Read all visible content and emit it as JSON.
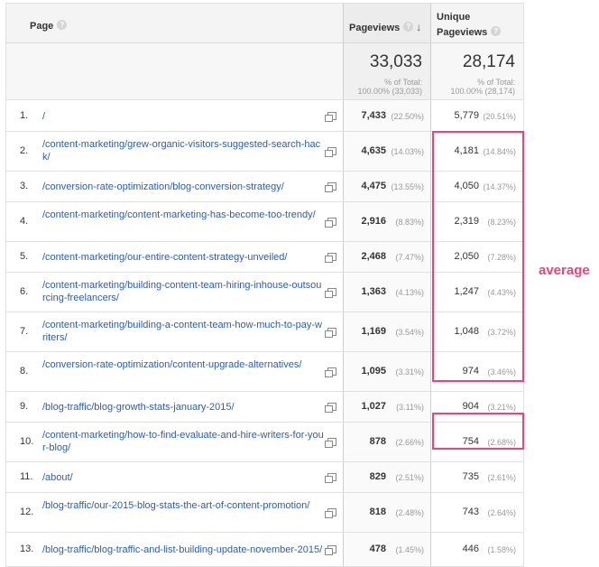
{
  "header": {
    "page_label": "Page",
    "pageviews_label": "Pageviews",
    "unique_label_line1": "Unique",
    "unique_label_line2": "Pageviews",
    "help_glyph": "?",
    "sort_glyph": "↓"
  },
  "totals": {
    "pageviews": "33,033",
    "pageviews_sub1": "% of Total:",
    "pageviews_sub2": "100.00% (33,033)",
    "unique": "28,174",
    "unique_sub1": "% of Total:",
    "unique_sub2": "100.00% (28,174)"
  },
  "rows": [
    {
      "rank": "1.",
      "url": "/",
      "pv": "7,433",
      "pv_pct": "(22.50%)",
      "upv": "5,779",
      "upv_pct": "(20.51%)"
    },
    {
      "rank": "2.",
      "url": "/content-marketing/grew-organic-visitors-suggested-search-hack/",
      "pv": "4,635",
      "pv_pct": "(14.03%)",
      "upv": "4,181",
      "upv_pct": "(14.84%)"
    },
    {
      "rank": "3.",
      "url": "/conversion-rate-optimization/blog-conversion-strategy/",
      "pv": "4,475",
      "pv_pct": "(13.55%)",
      "upv": "4,050",
      "upv_pct": "(14.37%)"
    },
    {
      "rank": "4.",
      "url": "/content-marketing/content-marketing-has-become-too-trendy/",
      "pv": "2,916",
      "pv_pct": "(8.83%)",
      "upv": "2,319",
      "upv_pct": "(8.23%)"
    },
    {
      "rank": "5.",
      "url": "/content-marketing/our-entire-content-strategy-unveiled/",
      "pv": "2,468",
      "pv_pct": "(7.47%)",
      "upv": "2,050",
      "upv_pct": "(7.28%)"
    },
    {
      "rank": "6.",
      "url": "/content-marketing/building-content-team-hiring-inhouse-outsourcing-freelancers/",
      "pv": "1,363",
      "pv_pct": "(4.13%)",
      "upv": "1,247",
      "upv_pct": "(4.43%)"
    },
    {
      "rank": "7.",
      "url": "/content-marketing/building-a-content-team-how-much-to-pay-writers/",
      "pv": "1,169",
      "pv_pct": "(3.54%)",
      "upv": "1,048",
      "upv_pct": "(3.72%)"
    },
    {
      "rank": "8.",
      "url": "/conversion-rate-optimization/content-upgrade-alternatives/",
      "pv": "1,095",
      "pv_pct": "(3.31%)",
      "upv": "974",
      "upv_pct": "(3.46%)"
    },
    {
      "rank": "9.",
      "url": "/blog-traffic/blog-growth-stats-january-2015/",
      "pv": "1,027",
      "pv_pct": "(3.11%)",
      "upv": "904",
      "upv_pct": "(3.21%)"
    },
    {
      "rank": "10.",
      "url": "/content-marketing/how-to-find-evaluate-and-hire-writers-for-your-blog/",
      "pv": "878",
      "pv_pct": "(2.66%)",
      "upv": "754",
      "upv_pct": "(2.68%)"
    },
    {
      "rank": "11.",
      "url": "/about/",
      "pv": "829",
      "pv_pct": "(2.51%)",
      "upv": "735",
      "upv_pct": "(2.61%)"
    },
    {
      "rank": "12.",
      "url": "/blog-traffic/our-2015-blog-stats-the-art-of-content-promotion/",
      "pv": "818",
      "pv_pct": "(2.48%)",
      "upv": "743",
      "upv_pct": "(2.64%)"
    },
    {
      "rank": "13.",
      "url": "/blog-traffic/blog-traffic-and-list-building-update-november-2015/",
      "pv": "478",
      "pv_pct": "(1.45%)",
      "upv": "446",
      "upv_pct": "(1.58%)"
    }
  ],
  "annotation": {
    "label": "average",
    "color": "#e8457a"
  },
  "colors": {
    "link": "#2a5db0",
    "highlight": "#e8457a"
  }
}
